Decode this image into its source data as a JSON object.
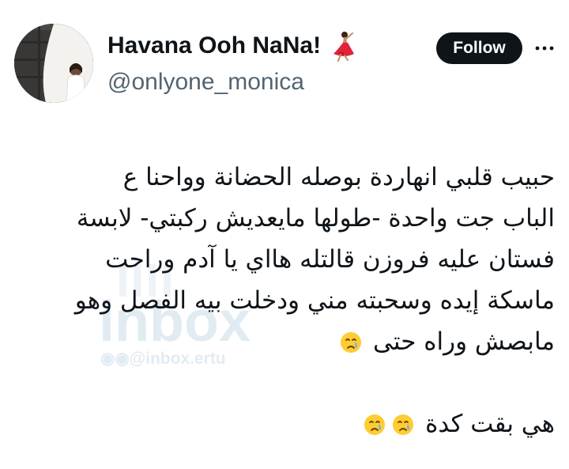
{
  "author": {
    "display_name": "Havana Ooh NaNa!",
    "display_name_emoji": "dancer-emoji",
    "handle": "@onlyone_monica"
  },
  "header": {
    "follow_label": "Follow",
    "more_icon": "more-horizontal-icon"
  },
  "tweet": {
    "lines": [
      "حبيب قلبي انهاردة بوصله الحضانة وواحنا ع",
      "الباب جت واحدة -طولها مايعديش ركبتي- لابسة",
      "فستان عليه فروزن قالتله هااي يا آدم وراحت",
      "ماسكة إيده وسحبته مني ودخلت بيه الفصل وهو",
      "مابصش وراه حتى"
    ],
    "final_line": "هي بقت كدة",
    "line5_emoji": "crying-face-emoji",
    "final_emojis": [
      "crying-face-emoji",
      "crying-face-emoji"
    ]
  },
  "watermark": {
    "brand": "inbox",
    "handle": "@inbox.ertu"
  },
  "colors": {
    "text_primary": "#0f1419",
    "text_secondary": "#536471",
    "button_bg": "#0f1419",
    "button_text": "#ffffff"
  }
}
